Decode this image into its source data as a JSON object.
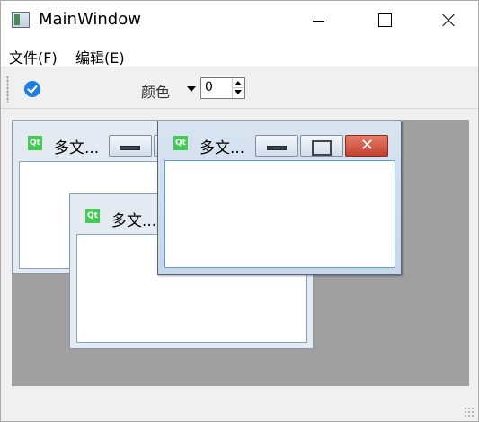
{
  "window": {
    "title": "MainWindow",
    "icon": "app-window-icon"
  },
  "menubar": {
    "items": [
      {
        "label": "文件(F)"
      },
      {
        "label": "编辑(E)"
      }
    ]
  },
  "toolbar": {
    "action_icon": "check-circle-icon",
    "color_label": "颜色",
    "spinbox_value": "0"
  },
  "mdi": {
    "subwindows": [
      {
        "title": "多文...",
        "icon": "qt-logo-icon"
      },
      {
        "title": "多文...",
        "icon": "qt-logo-icon"
      },
      {
        "title": "多文...",
        "icon": "qt-logo-icon"
      }
    ]
  },
  "colors": {
    "accent": "#1e7fe0",
    "mdi_background": "#a0a0a0",
    "close_button": "#c8483a"
  }
}
